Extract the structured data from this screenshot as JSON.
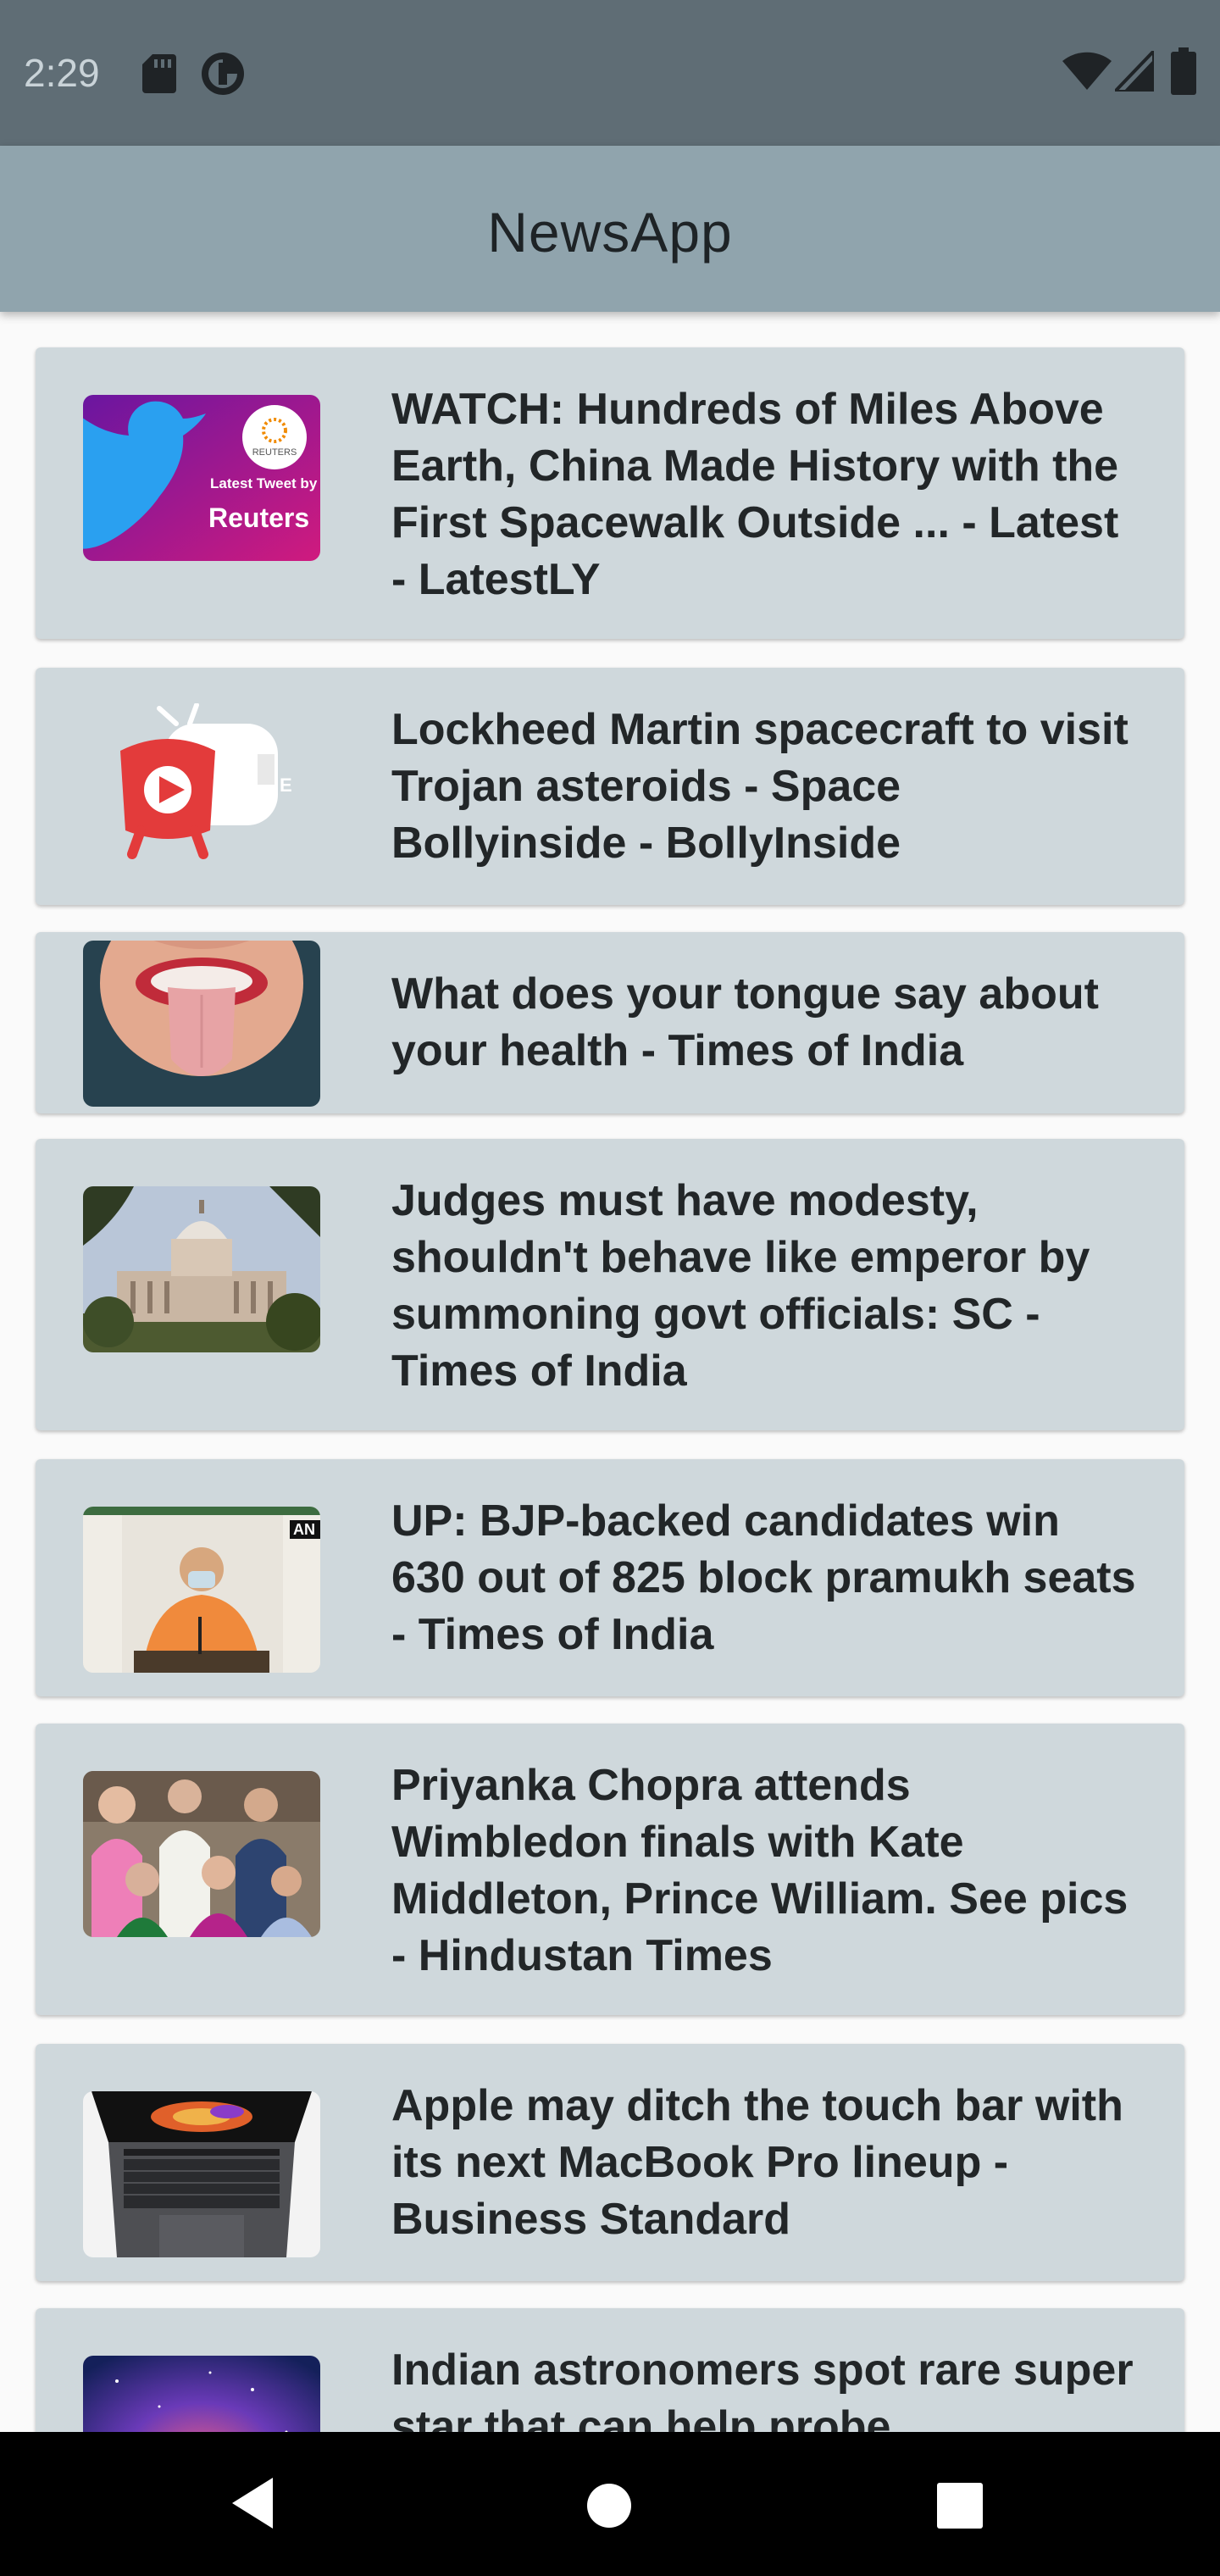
{
  "status_bar": {
    "time": "2:29",
    "left_icons": [
      "sd-card-icon",
      "data-saver-icon"
    ],
    "right_icons": [
      "wifi-icon",
      "cellular-signal-icon",
      "battery-icon"
    ]
  },
  "app_bar": {
    "title": "NewsApp"
  },
  "articles": [
    {
      "headline": "WATCH: Hundreds of Miles Above Earth, China Made History with the First Spacewalk Outside ... - Latest - LatestLY",
      "thumbnail_icon": "reuters-twitter-thumbnail",
      "thumbnail_text": [
        "REUTERS",
        "Latest Tweet by",
        "Reuters"
      ]
    },
    {
      "headline": "Lockheed Martin spacecraft to visit Trojan asteroids - Space Bollyinside - BollyInside",
      "thumbnail_icon": "youtube-tv-thumbnail"
    },
    {
      "headline": "What does your tongue say about your health - Times of India",
      "thumbnail_icon": "tongue-photo-thumbnail"
    },
    {
      "headline": "Judges must have modesty, shouldn't behave like emperor by summoning govt officials: SC - Times of India",
      "thumbnail_icon": "supreme-court-photo-thumbnail"
    },
    {
      "headline": "UP: BJP-backed candidates win 630 out of 825 block pramukh seats - Times of India",
      "thumbnail_icon": "press-conference-photo-thumbnail",
      "thumbnail_text": [
        "AN"
      ]
    },
    {
      "headline": "Priyanka Chopra attends Wimbledon finals with Kate Middleton, Prince William. See pics - Hindustan Times",
      "thumbnail_icon": "wimbledon-crowd-photo-thumbnail"
    },
    {
      "headline": "Apple may ditch the touch bar with its next MacBook Pro lineup - Business Standard",
      "thumbnail_icon": "macbook-photo-thumbnail"
    },
    {
      "headline": "Indian astronomers spot rare super star that can help probe",
      "thumbnail_icon": "nebula-photo-thumbnail"
    }
  ],
  "nav_bar": {
    "buttons": [
      "back-icon",
      "home-icon",
      "recents-icon"
    ]
  }
}
